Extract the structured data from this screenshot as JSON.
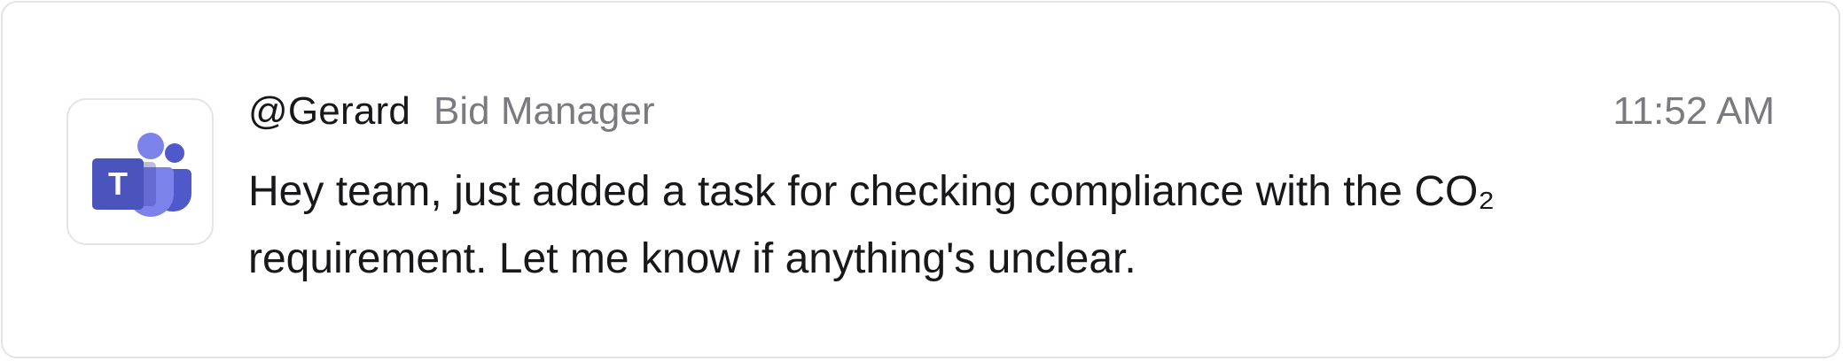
{
  "message_card": {
    "app_icon": "microsoft-teams-icon",
    "sender": "@Gerard",
    "role": "Bid Manager",
    "time": "11:52 AM",
    "text": "Hey team, just added a task for checking compliance with the CO₂ requirement. Let me know if anything's unclear."
  },
  "colors": {
    "text_primary": "#18181b",
    "text_secondary": "#7a7a80",
    "border": "#e4e4e7",
    "teams_purple": "#5059c9",
    "teams_light": "#7b83eb",
    "teams_dark": "#4b53bc"
  }
}
